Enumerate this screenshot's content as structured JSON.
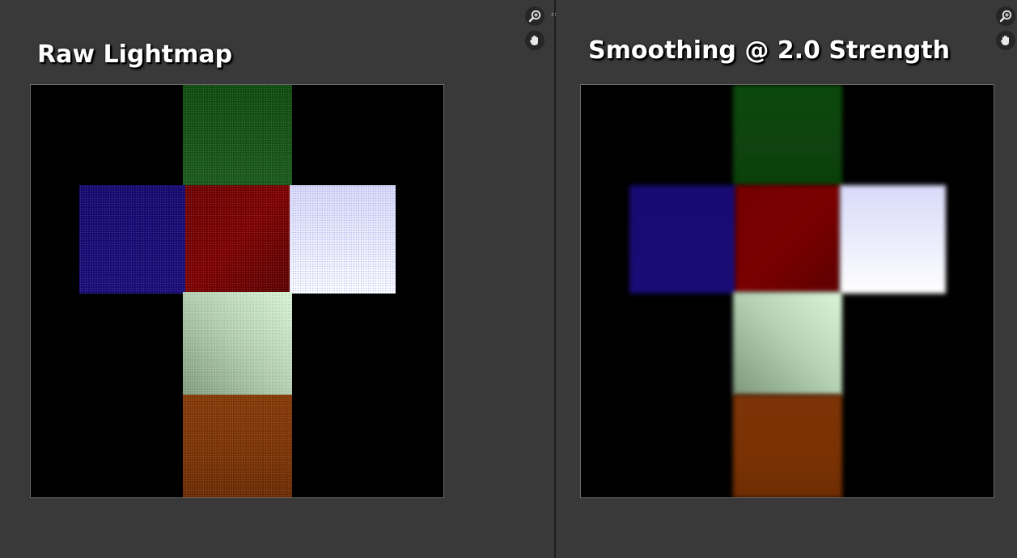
{
  "panes": {
    "left": {
      "title": "Raw Lightmap"
    },
    "right": {
      "title": "Smoothing @ 2.0 Strength"
    }
  },
  "toolbar_icons": [
    "zoom-in-icon",
    "pan-hand-icon"
  ],
  "divider": {
    "handle_glyph": "‹›"
  },
  "tile_colors": {
    "top": [
      "#0b3f0b",
      "#1d5e1d"
    ],
    "left": [
      "#16086e",
      "#1d0f7e"
    ],
    "center": [
      "#7f0000",
      "#560000"
    ],
    "right": [
      "#d6d8fb",
      "#ffffff"
    ],
    "lower": [
      "#8aa988",
      "#d8f2d8"
    ],
    "bottom": [
      "#8a3a07",
      "#6c2a02"
    ]
  }
}
